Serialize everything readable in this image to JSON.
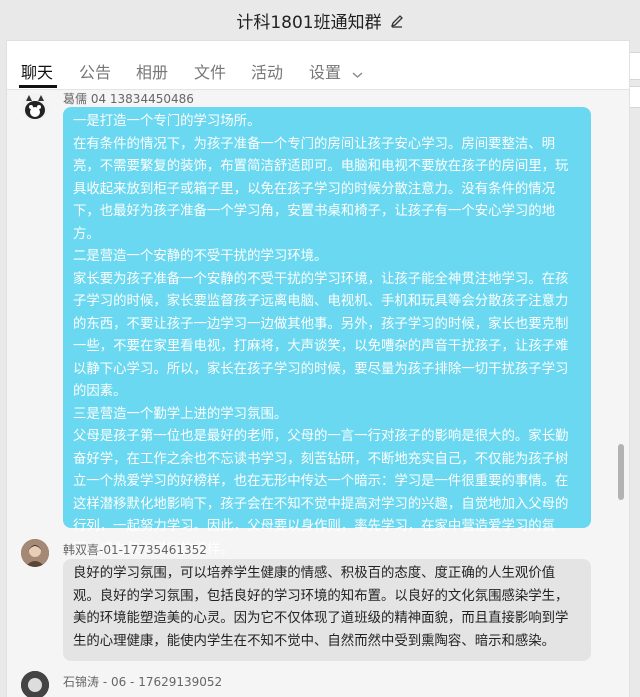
{
  "window": {
    "title": "计科1801班通知群",
    "title_icon": "pencil-edit-icon"
  },
  "tabs": [
    {
      "label": "聊天",
      "active": true
    },
    {
      "label": "公告",
      "active": false
    },
    {
      "label": "相册",
      "active": false
    },
    {
      "label": "文件",
      "active": false
    },
    {
      "label": "活动",
      "active": false
    },
    {
      "label": "设置",
      "active": false,
      "icon": "chevron-down-icon"
    }
  ],
  "messages": [
    {
      "sender": "葛儒 04 13834450486",
      "bubble_color": "#6ad8f0",
      "paragraphs": [
        "一是打造一个专门的学习场所。",
        "在有条件的情况下，为孩子准备一个专门的房间让孩子安心学习。房间要整洁、明亮，不需要繁复的装饰，布置简洁舒适即可。电脑和电视不要放在孩子的房间里，玩具收起来放到柜子或箱子里，以免在孩子学习的时候分散注意力。没有条件的情况下，也最好为孩子准备一个学习角，安置书桌和椅子，让孩子有一个安心学习的地方。",
        "二是营造一个安静的不受干扰的学习环境。",
        "家长要为孩子准备一个安静的不受干扰的学习环境，让孩子能全神贯注地学习。在孩子学习的时候，家长要监督孩子远离电脑、电视机、手机和玩具等会分散孩子注意力的东西，不要让孩子一边学习一边做其他事。另外，孩子学习的时候，家长也要克制一些，不要在家里看电视，打麻将，大声谈笑，以免嘈杂的声音干扰孩子，让孩子难以静下心学习。所以，家长在孩子学习的时候，要尽量为孩子排除一切干扰孩子学习的因素。",
        "三是营造一个勤学上进的学习氛围。",
        "父母是孩子第一位也是最好的老师，父母的一言一行对孩子的影响是很大的。家长勤奋好学，在工作之余也不忘读书学习，刻苦钻研，不断地充实自己，不仅能为孩子树立一个热爱学习的好榜样，也在无形中传达一个暗示：学习是一件很重要的事情。在这样潜移默化地影响下，孩子会在不知不觉中提高对学习的兴趣，自觉地加入父母的行列，一起努力学习。因此，父母要以身作则，率先学习，在家中营造爱学习的氛围，成为孩子学习的榜样。"
      ]
    },
    {
      "sender": "韩双喜-01-17735461352",
      "bubble_color": "#e4e4e4",
      "paragraphs": [
        "良好的学习氛围，可以培养学生健康的情感、积极百的态度、度正确的人生观价值观。良好的学习氛围，包括良好的学习环境的知布置。以良好的文化氛围感染学生，美的环境能塑造美的心灵。因为它不仅体现了道班级的精神面貌，而且直接影响到学生的心理健康，能使内学生在不知不觉中、自然而然中受到熏陶容、暗示和感染。"
      ]
    },
    {
      "sender": "石锦涛 - 06 - 17629139052",
      "bubble_color": "",
      "paragraphs": []
    }
  ]
}
